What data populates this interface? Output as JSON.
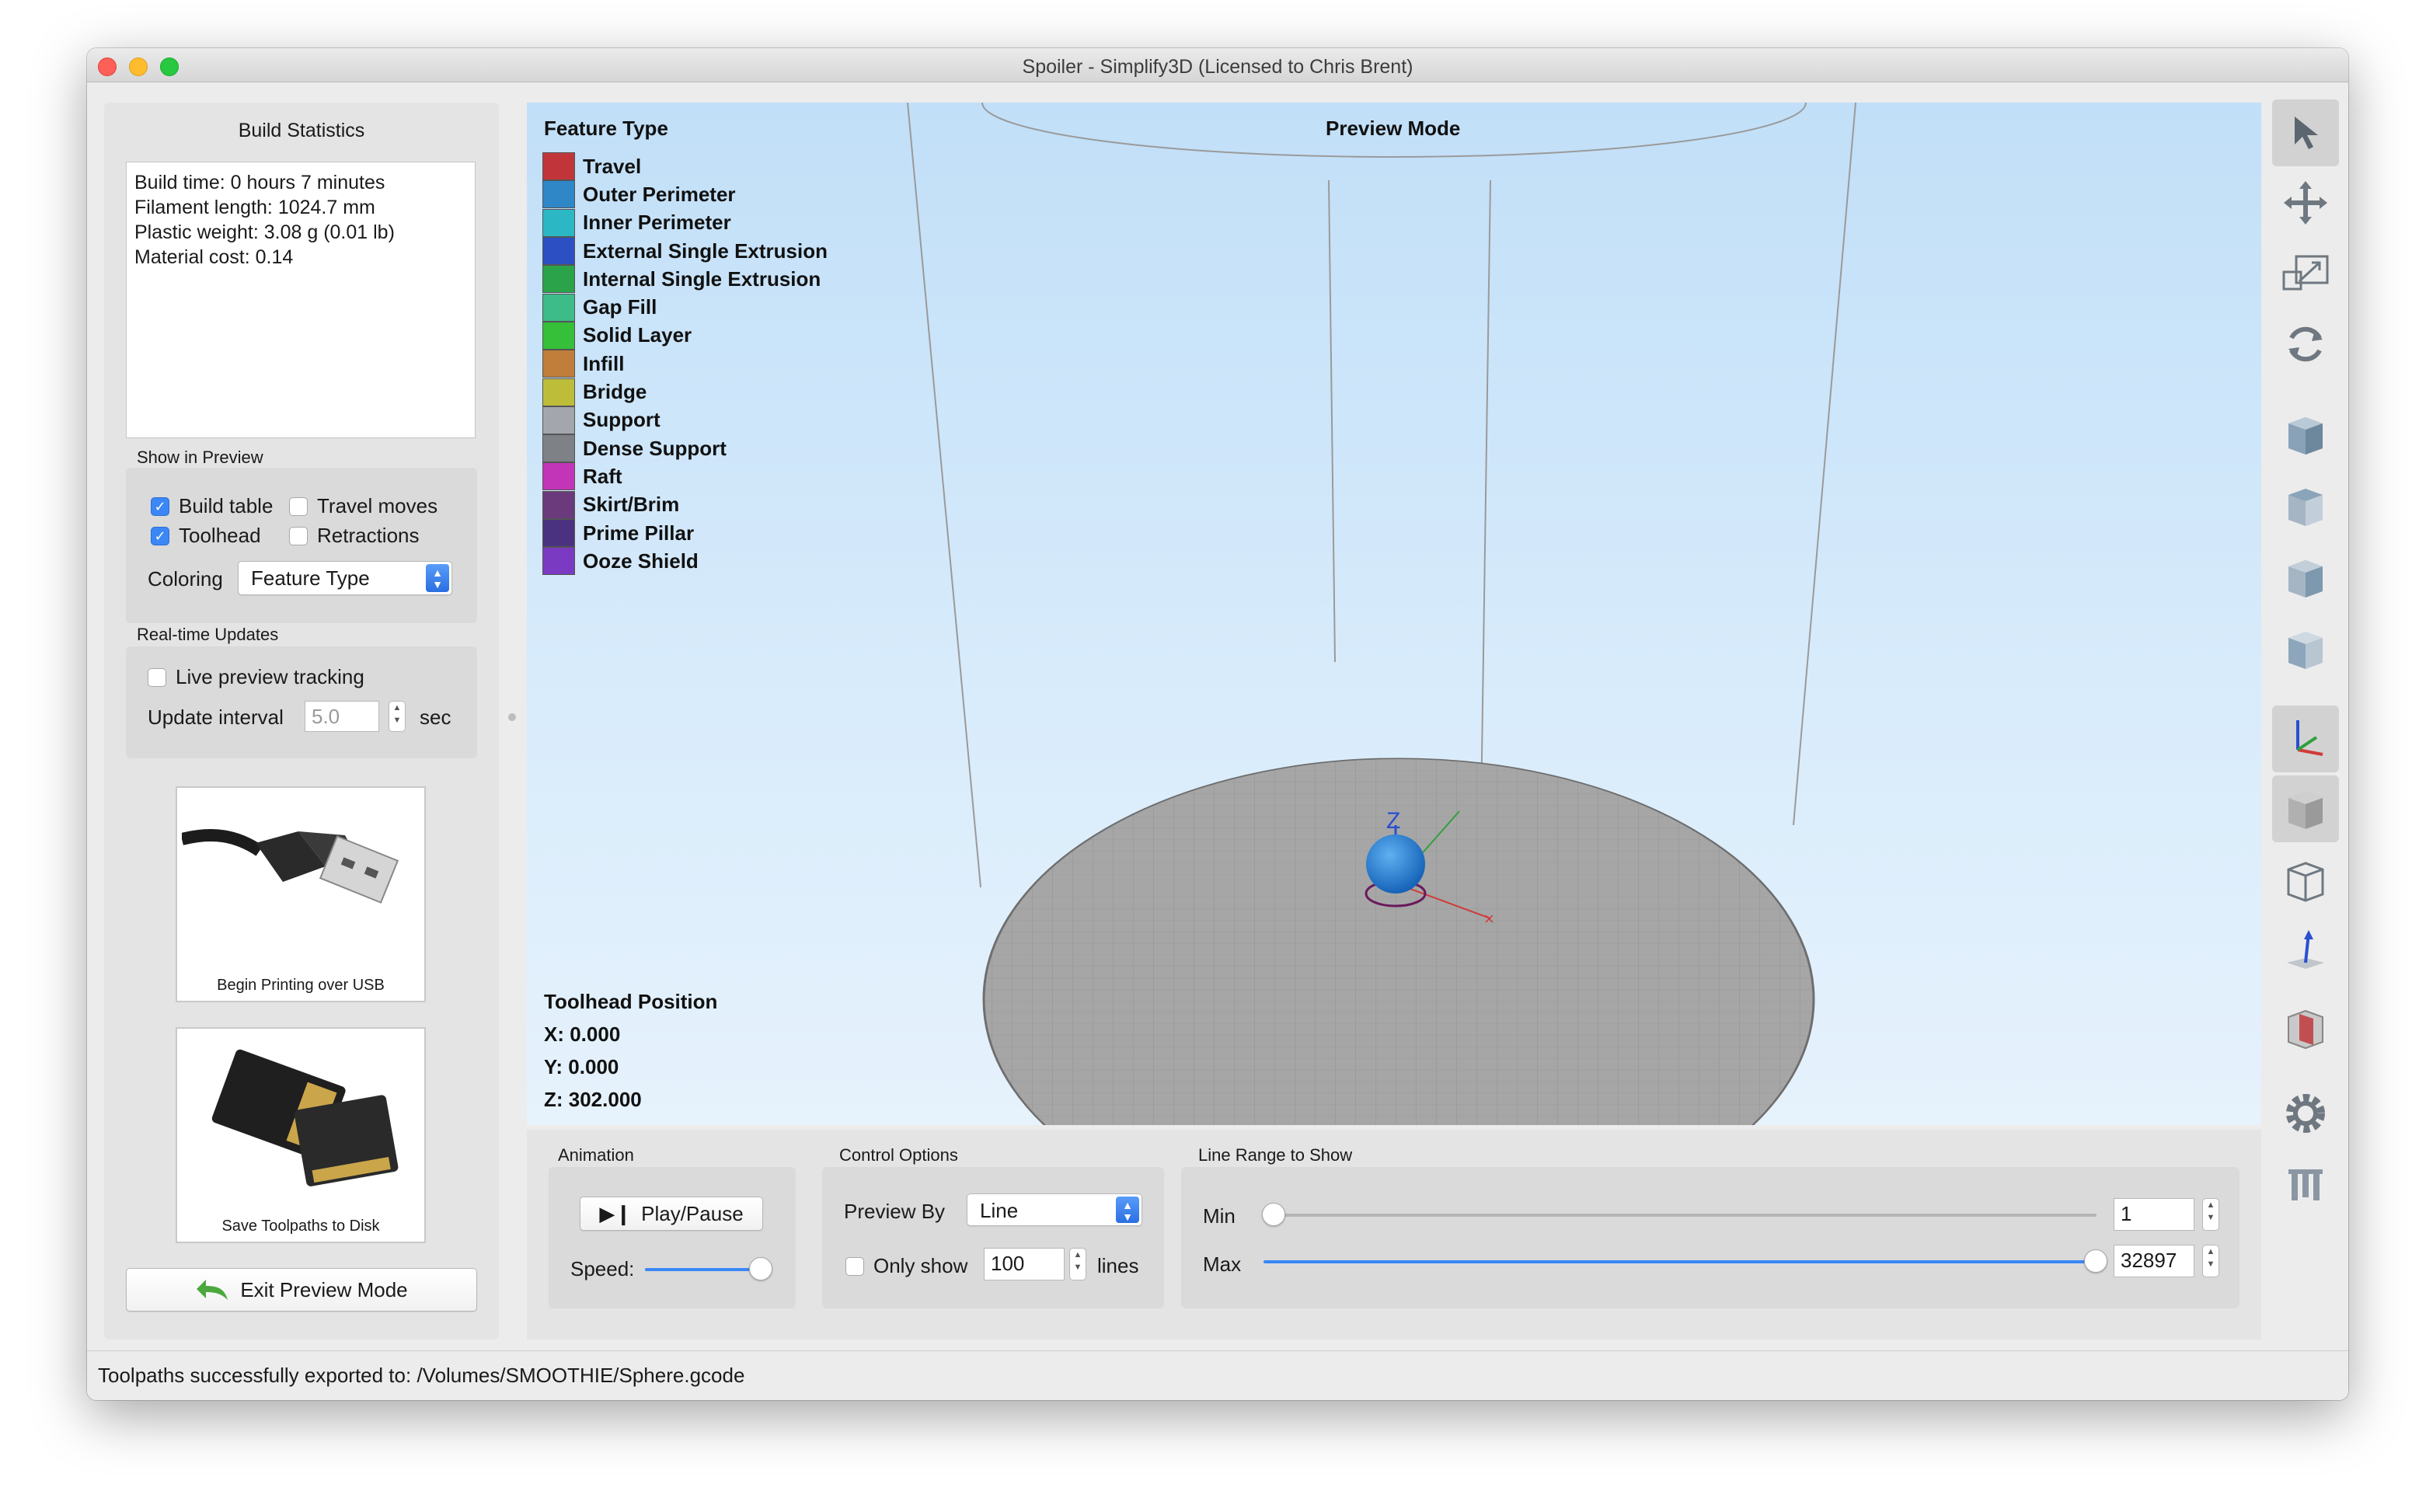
{
  "window": {
    "title": "Spoiler - Simplify3D (Licensed to Chris Brent)"
  },
  "left_panel": {
    "build_statistics": {
      "title": "Build Statistics",
      "lines": [
        "Build time: 0 hours 7 minutes",
        "Filament length: 1024.7 mm",
        "Plastic weight: 3.08 g (0.01 lb)",
        "Material cost: 0.14"
      ]
    },
    "show_in_preview": {
      "label": "Show in Preview",
      "build_table": {
        "label": "Build table",
        "checked": true
      },
      "travel_moves": {
        "label": "Travel moves",
        "checked": false
      },
      "toolhead": {
        "label": "Toolhead",
        "checked": true
      },
      "retractions": {
        "label": "Retractions",
        "checked": false
      },
      "coloring_label": "Coloring",
      "coloring_value": "Feature Type"
    },
    "realtime_updates": {
      "label": "Real-time Updates",
      "live_tracking": {
        "label": "Live preview tracking",
        "checked": false
      },
      "update_interval_label": "Update interval",
      "update_interval_value": "5.0",
      "unit": "sec"
    },
    "usb_card": {
      "caption": "Begin Printing over USB"
    },
    "sd_card": {
      "caption": "Save Toolpaths to Disk"
    },
    "exit_button": "Exit Preview Mode"
  },
  "viewport": {
    "feature_type_title": "Feature Type",
    "preview_mode_title": "Preview Mode",
    "legend": [
      {
        "label": "Travel",
        "color": "#c1353a"
      },
      {
        "label": "Outer Perimeter",
        "color": "#2f87c8"
      },
      {
        "label": "Inner Perimeter",
        "color": "#2bb8c4"
      },
      {
        "label": "External Single Extrusion",
        "color": "#2d4fc4"
      },
      {
        "label": "Internal Single Extrusion",
        "color": "#2ba34a"
      },
      {
        "label": "Gap Fill",
        "color": "#3dbc8a"
      },
      {
        "label": "Solid Layer",
        "color": "#36c039"
      },
      {
        "label": "Infill",
        "color": "#c17e3a"
      },
      {
        "label": "Bridge",
        "color": "#bebd3a"
      },
      {
        "label": "Support",
        "color": "#a3a7ad"
      },
      {
        "label": "Dense Support",
        "color": "#7e8186"
      },
      {
        "label": "Raft",
        "color": "#c235b8"
      },
      {
        "label": "Skirt/Brim",
        "color": "#6b3a7c"
      },
      {
        "label": "Prime Pillar",
        "color": "#4a3280"
      },
      {
        "label": "Ooze Shield",
        "color": "#7b3ac2"
      }
    ],
    "toolhead_position": {
      "title": "Toolhead Position",
      "x": "X: 0.000",
      "y": "Y: 0.000",
      "z": "Z: 302.000"
    }
  },
  "controls": {
    "animation": {
      "label": "Animation",
      "play_pause": "Play/Pause",
      "speed_label": "Speed:"
    },
    "control_options": {
      "label": "Control Options",
      "preview_by_label": "Preview By",
      "preview_by_value": "Line",
      "only_show_label": "Only show",
      "only_show_value": "100",
      "only_show_checked": false,
      "lines_label": "lines"
    },
    "line_range": {
      "label": "Line Range to Show",
      "min_label": "Min",
      "min_value": "1",
      "max_label": "Max",
      "max_value": "32897"
    }
  },
  "toolbar": {
    "tools": [
      "select-pointer-icon",
      "move-icon",
      "scale-icon",
      "rotate-icon",
      "view-front-icon",
      "view-top-icon",
      "view-side-icon",
      "view-back-icon",
      "axes-icon",
      "solid-view-icon",
      "wireframe-view-icon",
      "normals-icon",
      "cross-section-icon",
      "settings-gear-icon",
      "support-structures-icon"
    ]
  },
  "status_bar": {
    "text": "Toolpaths successfully exported to: /Volumes/SMOOTHIE/Sphere.gcode"
  }
}
